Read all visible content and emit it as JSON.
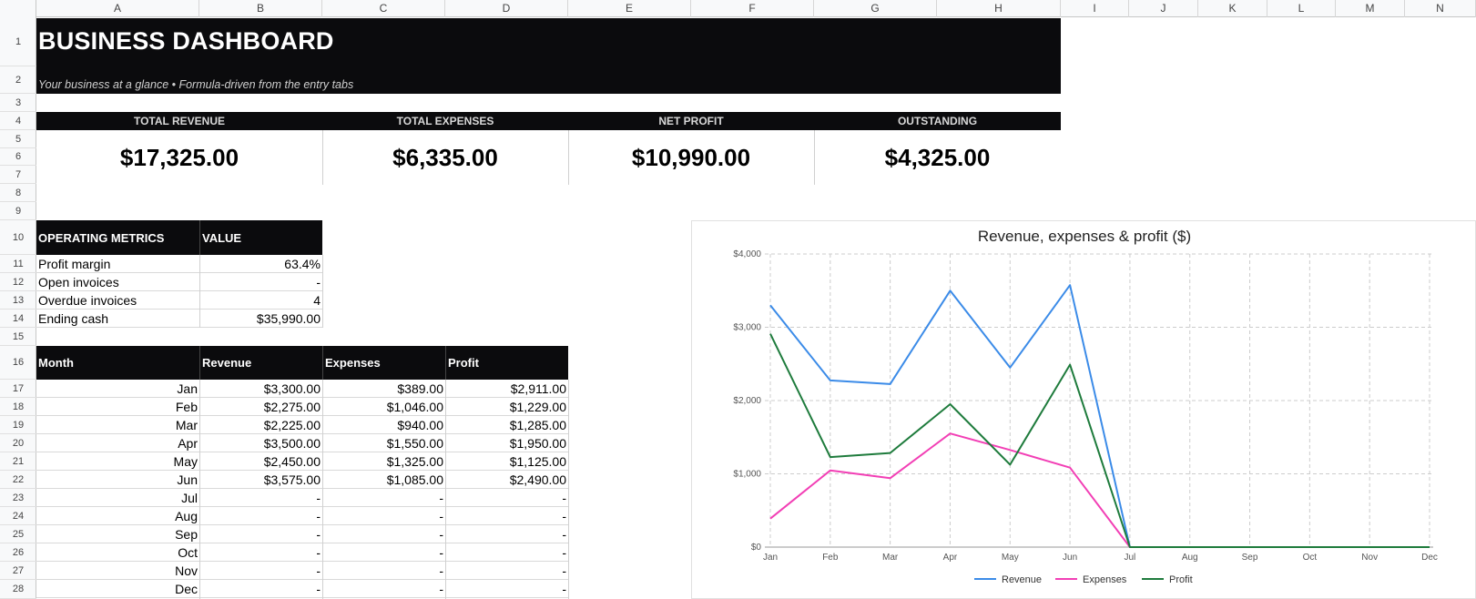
{
  "columns": [
    "A",
    "B",
    "C",
    "D",
    "E",
    "F",
    "G",
    "H",
    "I",
    "J",
    "K",
    "L",
    "M",
    "N"
  ],
  "rows": [
    "1",
    "2",
    "3",
    "4",
    "5",
    "6",
    "7",
    "8",
    "9",
    "10",
    "11",
    "12",
    "13",
    "14",
    "15",
    "16",
    "17",
    "18",
    "19",
    "20",
    "21",
    "22",
    "23",
    "24",
    "25",
    "26",
    "27",
    "28"
  ],
  "dashboard": {
    "title": "BUSINESS DASHBOARD",
    "subtitle": "Your business at a glance • Formula-driven from the entry tabs"
  },
  "kpis": [
    {
      "label": "TOTAL REVENUE",
      "value": "$17,325.00"
    },
    {
      "label": "TOTAL EXPENSES",
      "value": "$6,335.00"
    },
    {
      "label": "NET PROFIT",
      "value": "$10,990.00"
    },
    {
      "label": "OUTSTANDING",
      "value": "$4,325.00"
    }
  ],
  "metrics": {
    "header": [
      "OPERATING METRICS",
      "VALUE"
    ],
    "rows": [
      {
        "label": "Profit margin",
        "value": "63.4%"
      },
      {
        "label": "Open invoices",
        "value": "-"
      },
      {
        "label": "Overdue invoices",
        "value": "4"
      },
      {
        "label": "Ending cash",
        "value": "$35,990.00"
      }
    ]
  },
  "monthly": {
    "header": [
      "Month",
      "Revenue",
      "Expenses",
      "Profit"
    ],
    "rows": [
      {
        "month": "Jan",
        "revenue": "$3,300.00",
        "expenses": "$389.00",
        "profit": "$2,911.00"
      },
      {
        "month": "Feb",
        "revenue": "$2,275.00",
        "expenses": "$1,046.00",
        "profit": "$1,229.00"
      },
      {
        "month": "Mar",
        "revenue": "$2,225.00",
        "expenses": "$940.00",
        "profit": "$1,285.00"
      },
      {
        "month": "Apr",
        "revenue": "$3,500.00",
        "expenses": "$1,550.00",
        "profit": "$1,950.00"
      },
      {
        "month": "May",
        "revenue": "$2,450.00",
        "expenses": "$1,325.00",
        "profit": "$1,125.00"
      },
      {
        "month": "Jun",
        "revenue": "$3,575.00",
        "expenses": "$1,085.00",
        "profit": "$2,490.00"
      },
      {
        "month": "Jul",
        "revenue": "-",
        "expenses": "-",
        "profit": "-"
      },
      {
        "month": "Aug",
        "revenue": "-",
        "expenses": "-",
        "profit": "-"
      },
      {
        "month": "Sep",
        "revenue": "-",
        "expenses": "-",
        "profit": "-"
      },
      {
        "month": "Oct",
        "revenue": "-",
        "expenses": "-",
        "profit": "-"
      },
      {
        "month": "Nov",
        "revenue": "-",
        "expenses": "-",
        "profit": "-"
      },
      {
        "month": "Dec",
        "revenue": "-",
        "expenses": "-",
        "profit": "-"
      }
    ]
  },
  "colors": {
    "header_bg": "#0b0b0d",
    "revenue": "#3b8be8",
    "expenses": "#f23fb5",
    "profit": "#1e7b3c"
  },
  "chart_data": {
    "type": "line",
    "title": "Revenue, expenses & profit ($)",
    "categories": [
      "Jan",
      "Feb",
      "Mar",
      "Apr",
      "May",
      "Jun",
      "Jul",
      "Aug",
      "Sep",
      "Oct",
      "Nov",
      "Dec"
    ],
    "y_ticks": [
      "$0",
      "$1,000",
      "$2,000",
      "$3,000",
      "$4,000"
    ],
    "ylim": [
      0,
      4000
    ],
    "grid": true,
    "legend_position": "bottom",
    "series": [
      {
        "name": "Revenue",
        "color": "#3b8be8",
        "values": [
          3300,
          2275,
          2225,
          3500,
          2450,
          3575,
          0,
          0,
          0,
          0,
          0,
          0
        ]
      },
      {
        "name": "Expenses",
        "color": "#f23fb5",
        "values": [
          389,
          1046,
          940,
          1550,
          1325,
          1085,
          0,
          0,
          0,
          0,
          0,
          0
        ]
      },
      {
        "name": "Profit",
        "color": "#1e7b3c",
        "values": [
          2911,
          1229,
          1285,
          1950,
          1125,
          2490,
          0,
          0,
          0,
          0,
          0,
          0
        ]
      }
    ]
  }
}
